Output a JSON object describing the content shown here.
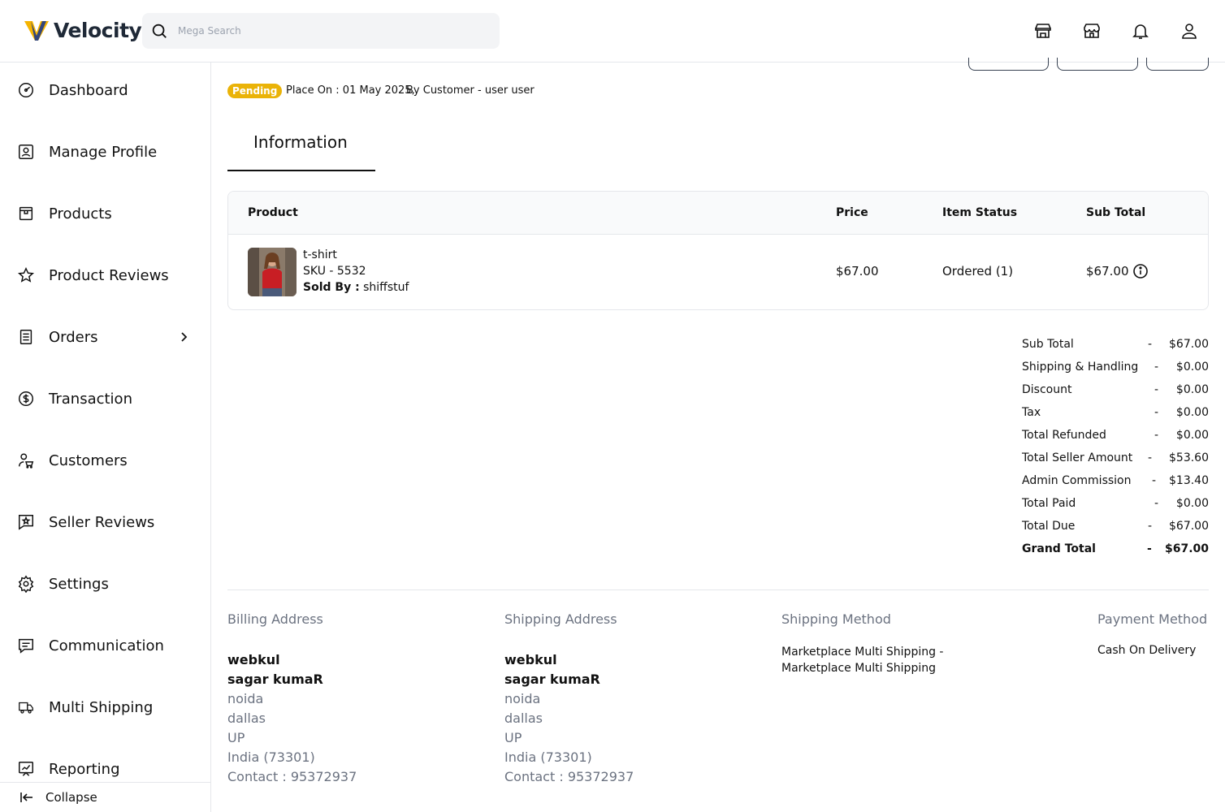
{
  "header": {
    "brand": "Velocity",
    "search_placeholder": "Mega Search",
    "icons": [
      "store-icon",
      "marketplace-icon",
      "bell-icon",
      "user-icon"
    ]
  },
  "sidebar": {
    "items": [
      {
        "label": "Dashboard",
        "icon": "dashboard-icon"
      },
      {
        "label": "Manage Profile",
        "icon": "profile-icon"
      },
      {
        "label": "Products",
        "icon": "products-icon"
      },
      {
        "label": "Product Reviews",
        "icon": "star-icon"
      },
      {
        "label": "Orders",
        "icon": "orders-icon"
      },
      {
        "label": "Transaction",
        "icon": "dollar-icon"
      },
      {
        "label": "Customers",
        "icon": "customers-icon"
      },
      {
        "label": "Seller Reviews",
        "icon": "seller-review-icon"
      },
      {
        "label": "Settings",
        "icon": "gear-icon"
      },
      {
        "label": "Communication",
        "icon": "chat-icon"
      },
      {
        "label": "Multi Shipping",
        "icon": "truck-icon"
      },
      {
        "label": "Reporting",
        "icon": "report-icon"
      }
    ],
    "collapse_label": "Collapse"
  },
  "order": {
    "status": "Pending",
    "placed_on": "Place On : 01 May 2025,",
    "by_customer": "By Customer - user user",
    "tab": "Information"
  },
  "table": {
    "headers": {
      "product": "Product",
      "price": "Price",
      "status": "Item Status",
      "subtotal": "Sub Total"
    },
    "row": {
      "name": "t-shirt",
      "sku": "SKU - 5532",
      "sold_by_label": "Sold By :",
      "sold_by": "shiffstuf",
      "price": "$67.00",
      "status": "Ordered (1)",
      "subtotal": "$67.00"
    }
  },
  "summary": [
    {
      "label": "Sub Total",
      "value": "$67.00"
    },
    {
      "label": "Shipping & Handling",
      "value": "$0.00"
    },
    {
      "label": "Discount",
      "value": "$0.00"
    },
    {
      "label": "Tax",
      "value": "$0.00"
    },
    {
      "label": "Total Refunded",
      "value": "$0.00"
    },
    {
      "label": "Total Seller Amount",
      "value": "$53.60"
    },
    {
      "label": "Admin Commission",
      "value": "$13.40"
    },
    {
      "label": "Total Paid",
      "value": "$0.00"
    },
    {
      "label": "Total Due",
      "value": "$67.00"
    },
    {
      "label": "Grand Total",
      "value": "$67.00"
    }
  ],
  "summary_dash": "-",
  "billing": {
    "title": "Billing Address",
    "company": "webkul",
    "name": "sagar kumaR",
    "line1": "noida",
    "city": "dallas",
    "state": "UP",
    "country": "India (73301)",
    "contact": "Contact : 95372937"
  },
  "shipping": {
    "title": "Shipping Address",
    "company": "webkul",
    "name": "sagar kumaR",
    "line1": "noida",
    "city": "dallas",
    "state": "UP",
    "country": "India (73301)",
    "contact": "Contact : 95372937"
  },
  "shipping_method": {
    "title": "Shipping Method",
    "value": "Marketplace Multi Shipping - Marketplace Multi Shipping"
  },
  "payment_method": {
    "title": "Payment Method",
    "value": "Cash On Delivery"
  },
  "colors": {
    "badge": "#eab308",
    "accent": "#111111",
    "logo_yellow": "#f5b400",
    "logo_blue": "#1e40af"
  }
}
